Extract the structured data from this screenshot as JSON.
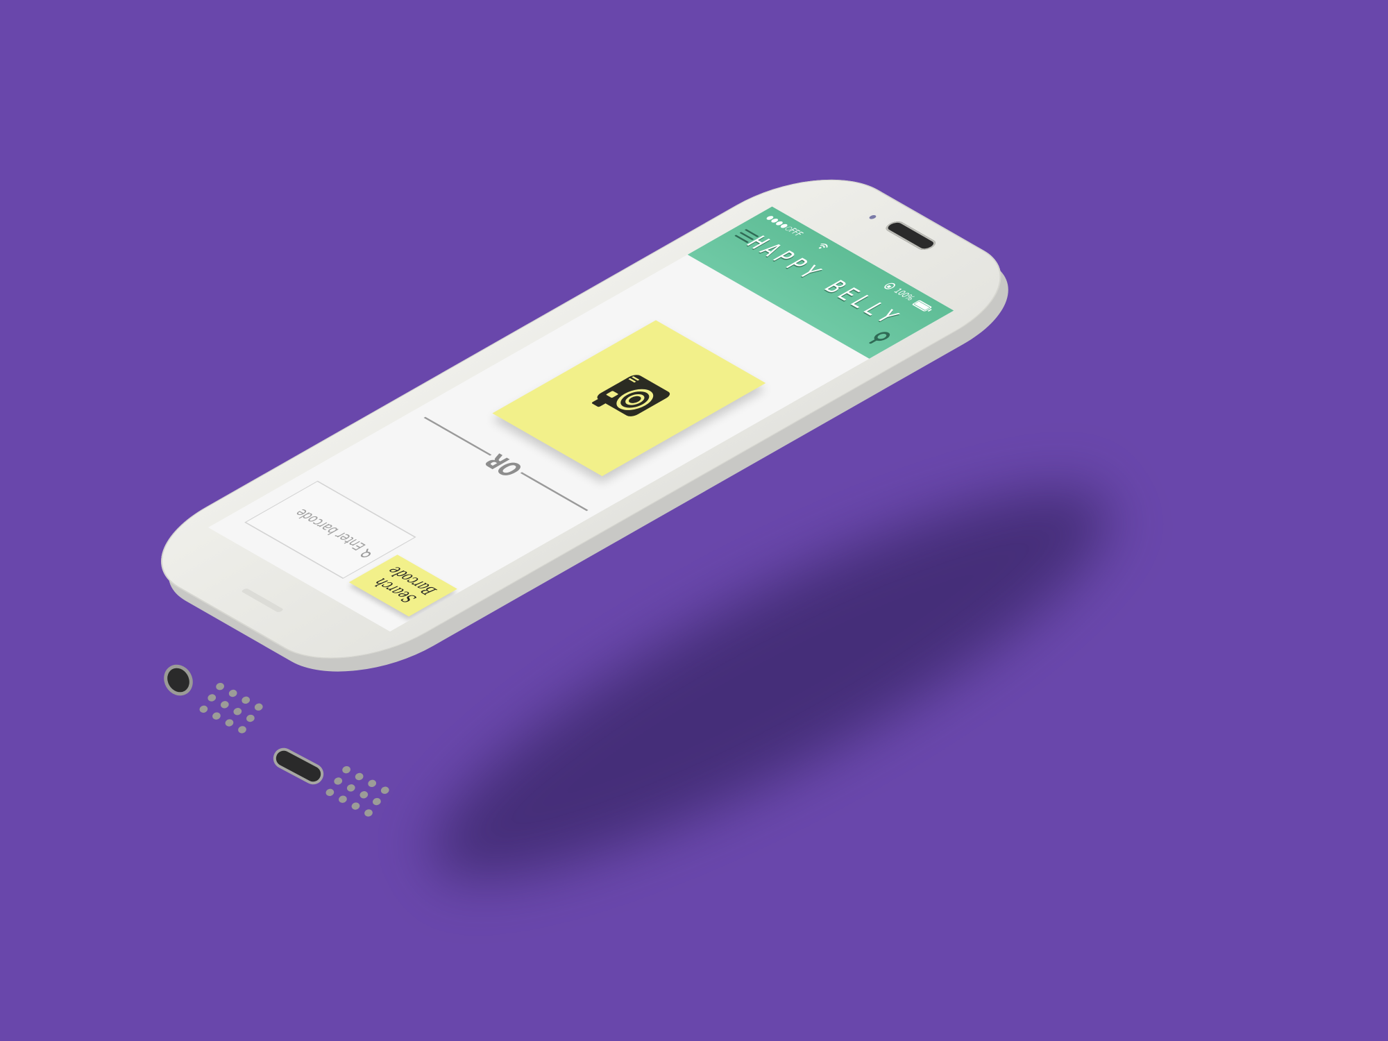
{
  "status_bar": {
    "signal_dots": "●●●●○",
    "carrier": "FFF",
    "wifi_icon": "wifi-icon",
    "battery_percent": "100%"
  },
  "header": {
    "title": "HAPPY BELLY",
    "menu_icon": "menu-icon",
    "search_icon": "search-icon"
  },
  "scan": {
    "camera_icon": "camera-icon"
  },
  "divider": {
    "label": "OR"
  },
  "barcode": {
    "placeholder": "Enter barcode",
    "value": "",
    "button_label": "Search Barcode"
  },
  "colors": {
    "background": "#6947ab",
    "header_green": "#5fbd96",
    "note_yellow": "#f2f08a",
    "screen": "#f6f6f6"
  }
}
